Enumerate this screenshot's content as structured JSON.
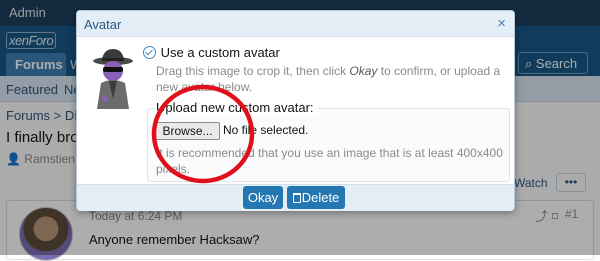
{
  "app": {
    "topbar_label": "Admin",
    "logo_text": "xenForo",
    "nav_tab_active": "Forums",
    "nav_tab_next": "W",
    "search_label": "Search",
    "subnav_featured": "Featured",
    "subnav_next": "Ne"
  },
  "thread": {
    "breadcrumb": "Forums > DIS",
    "title": "I finally brok",
    "starter": "Ramstien",
    "watch_label": "Watch",
    "more_label": "•••"
  },
  "post": {
    "date": "Today at 6:24 PM",
    "text": "Anyone remember Hacksaw?",
    "number": "#1"
  },
  "modal": {
    "title": "Avatar",
    "close_glyph": "×",
    "option_label": "Use a custom avatar",
    "hint_crop_1": "Drag this image to crop it, then click ",
    "hint_crop_em": "Okay",
    "hint_crop_2": " to confirm, or upload a new avatar below.",
    "upload_label": "Upload new custom avatar:",
    "browse_label": "Browse...",
    "file_status": "No file selected.",
    "size_hint": "It is recommended that you use an image that is at least 400x400 pixels.",
    "okay_label": "Okay",
    "delete_label": "Delete"
  },
  "colors": {
    "header": "#185886",
    "topbar": "#1d3e5d",
    "primary_button": "#2577b1",
    "annotation": "#e0101a",
    "modal_header": "#e4eef7"
  },
  "icons": {
    "close": "close-icon",
    "check": "check-circle-icon",
    "trash": "trash-icon",
    "search": "search-icon",
    "share": "share-icon",
    "bookmark": "bookmark-icon",
    "avatar": "spy-avatar-icon"
  }
}
